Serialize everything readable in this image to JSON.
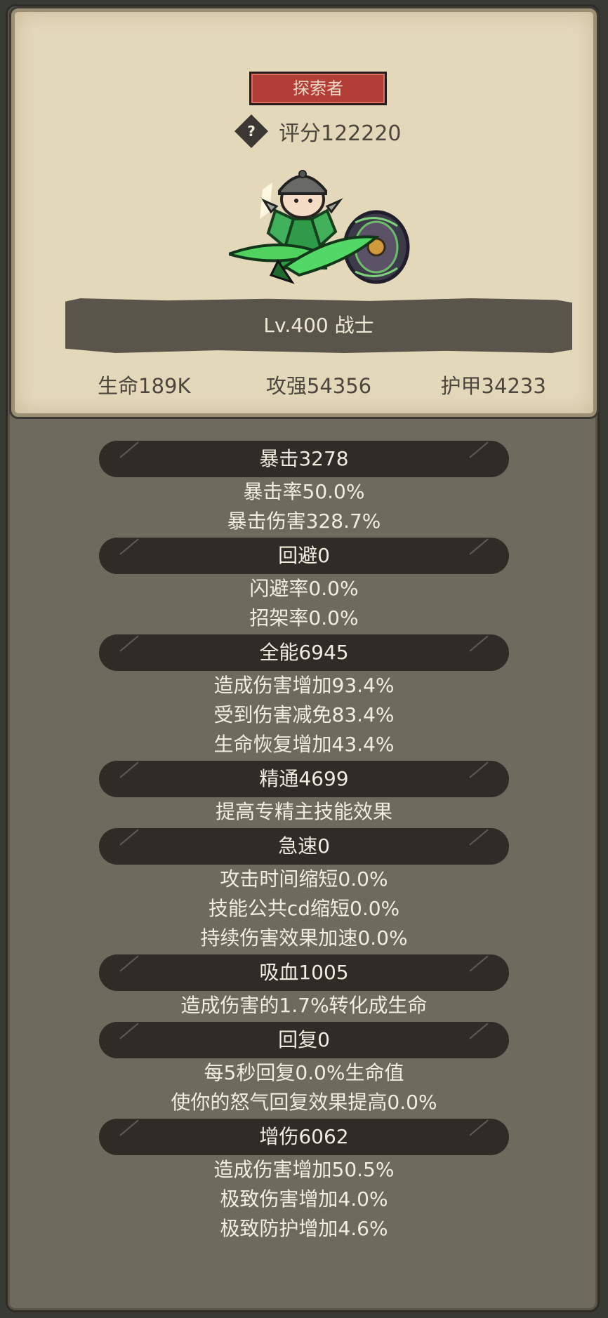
{
  "header": {
    "title_badge": "探索者",
    "score_text": "评分122220",
    "help_symbol": "?"
  },
  "character": {
    "level_text": "Lv.400 战士",
    "hp": "生命189K",
    "attack": "攻强54356",
    "armor": "护甲34233"
  },
  "sections": [
    {
      "title": "暴击3278",
      "lines": [
        "暴击率50.0%",
        "暴击伤害328.7%"
      ]
    },
    {
      "title": "回避0",
      "lines": [
        "闪避率0.0%",
        "招架率0.0%"
      ]
    },
    {
      "title": "全能6945",
      "lines": [
        "造成伤害增加93.4%",
        "受到伤害减免83.4%",
        "生命恢复增加43.4%"
      ]
    },
    {
      "title": "精通4699",
      "lines": [
        "提高专精主技能效果"
      ]
    },
    {
      "title": "急速0",
      "lines": [
        "攻击时间缩短0.0%",
        "技能公共cd缩短0.0%",
        "持续伤害效果加速0.0%"
      ]
    },
    {
      "title": "吸血1005",
      "lines": [
        "造成伤害的1.7%转化成生命"
      ]
    },
    {
      "title": "回复0",
      "lines": [
        "每5秒回复0.0%生命值",
        "使你的怒气回复效果提高0.0%"
      ]
    },
    {
      "title": "增伤6062",
      "lines": [
        "造成伤害增加50.5%",
        "极致伤害增加4.0%",
        "极致防护增加4.6%"
      ]
    }
  ],
  "colors": {
    "badge": "#b33d37",
    "card": "#e4d8bb",
    "panel": "#6e6a5d",
    "section_bar": "#2f2c27"
  }
}
